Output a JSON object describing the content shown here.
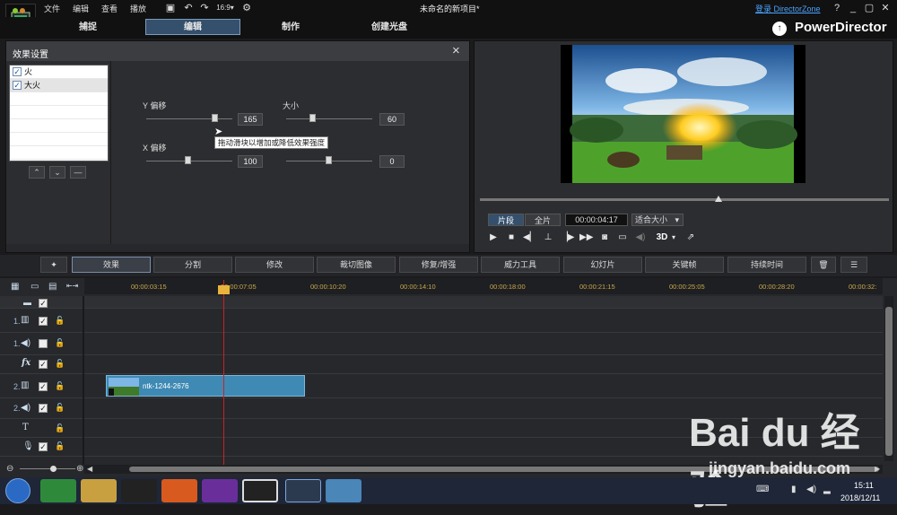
{
  "titlebar": {
    "menus": [
      "文件",
      "编辑",
      "查看",
      "播放"
    ],
    "document_title": "未命名的新项目*",
    "login_link": "登录 DirectorZone",
    "help": "?"
  },
  "modes": {
    "tabs": [
      {
        "label": "捕捉"
      },
      {
        "label": "编辑",
        "active": true
      },
      {
        "label": "制作"
      },
      {
        "label": "创建光盘"
      }
    ]
  },
  "brand": {
    "name": "PowerDirector"
  },
  "effect_panel": {
    "title": "效果设置",
    "effects": [
      {
        "label": "火",
        "checked": true
      },
      {
        "label": "大火",
        "checked": true
      }
    ],
    "params": {
      "y_offset": {
        "label": "Y 偏移",
        "value": "165"
      },
      "size": {
        "label": "大小",
        "value": "60"
      },
      "x_offset": {
        "label": "X 偏移",
        "value": "100"
      },
      "unnamed": {
        "value": "0"
      }
    },
    "tooltip": "拖动滑块以增加或降低效果强度"
  },
  "preview": {
    "segment_label": "片段",
    "full_label": "全片",
    "timecode": "00:00:04:17",
    "fit_option": "适合大小",
    "three_d_label": "3D"
  },
  "toolbar": {
    "buttons": [
      "效果",
      "分割",
      "修改",
      "裁切图像",
      "修复/增强",
      "威力工具",
      "幻灯片",
      "关键帧",
      "持续时间"
    ],
    "active": "效果"
  },
  "timeline": {
    "ticks": [
      "00:00:03:15",
      "00:00:07:05",
      "00:00:10:20",
      "00:00:14:10",
      "00:00:18:00",
      "00:00:21:15",
      "00:00:25:05",
      "00:00:28:20",
      "00:00:32:"
    ],
    "tracks": [
      {
        "number": "1.",
        "type": "video",
        "checked": true
      },
      {
        "number": "1.",
        "type": "audio",
        "checked": false
      },
      {
        "number": "",
        "type": "fx",
        "checked": true
      },
      {
        "number": "2.",
        "type": "video",
        "checked": true
      },
      {
        "number": "2.",
        "type": "audio",
        "checked": true
      },
      {
        "number": "",
        "type": "title",
        "checked": null
      },
      {
        "number": "",
        "type": "voice",
        "checked": true
      }
    ],
    "clip_name": "ntk-1244-2676"
  },
  "taskbar": {
    "time": "15:11",
    "date": "2018/12/11"
  },
  "watermark": {
    "logo": "Bai du 经验",
    "url": "jingyan.baidu.com"
  },
  "colors": {
    "accent_blue": "#34506c",
    "clip_blue": "#3e8ab4",
    "playhead": "#d02020",
    "ruler_text": "#c9a84a"
  }
}
